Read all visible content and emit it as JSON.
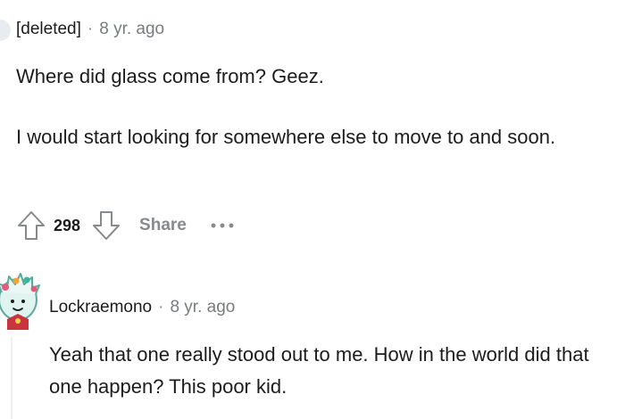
{
  "comments": [
    {
      "author": "[deleted]",
      "separator": "·",
      "time": "8 yr. ago",
      "paragraphs": [
        "Where did glass come from? Geez.",
        "I would start looking for somewhere else to move to and soon."
      ],
      "score": "298",
      "share_label": "Share",
      "more_label": "···"
    },
    {
      "author": "Lockraemono",
      "separator": "·",
      "time": "8 yr. ago",
      "paragraphs": [
        "Yeah that one really stood out to me. How in the world did that one happen? This poor kid."
      ]
    }
  ],
  "icons": {
    "upvote": "arrow-up-outline-icon",
    "downvote": "arrow-down-outline-icon",
    "more": "ellipsis-icon"
  },
  "colors": {
    "text": "#1c1c1c",
    "meta": "#787c7e",
    "action_gray": "#878a8c",
    "thread_line": "#edeff1"
  }
}
